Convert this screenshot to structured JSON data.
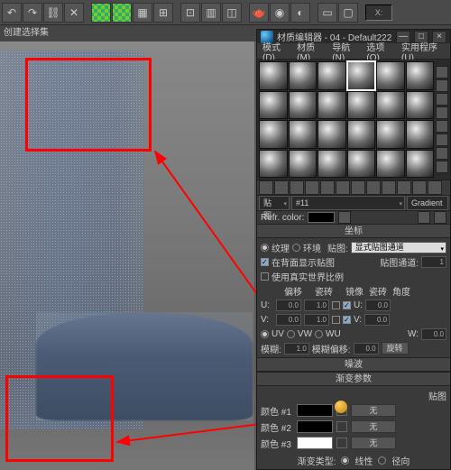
{
  "toolbar": {
    "label_creation": "创建选择集",
    "x_field": "X:"
  },
  "editor": {
    "title": "材质编辑器 - 04 - Default222",
    "menu": {
      "mode": "模式(D)",
      "material": "材质(M)",
      "nav": "导航(N)",
      "options": "选项(O)",
      "util": "实用程序(U)"
    },
    "slot_name_label": "贴图",
    "slot_name": "#11",
    "gradient": "Gradient",
    "refr_label": "Refr. color:"
  },
  "coords": {
    "head": "坐标",
    "tex": "纹理",
    "env": "环境",
    "map": "贴图:",
    "map_type": "显式贴图通道",
    "show_back": "在背面显示贴图",
    "map_ch": "贴图通道:",
    "ch_val": "1",
    "use_real": "使用真实世界比例",
    "offset": "偏移",
    "tile": "瓷砖",
    "mirror": "镜像",
    "tile2": "瓷砖",
    "angle": "角度",
    "u": "U:",
    "v": "V:",
    "w": "W:",
    "wu": "WU",
    "u_off": "0.0",
    "u_tile": "1.0",
    "u_ang": "0.0",
    "v_off": "0.0",
    "v_tile": "1.0",
    "v_ang": "0.0",
    "w_ang": "0.0",
    "uv": "UV",
    "vw": "VW",
    "blur": "模糊:",
    "blur_v": "1.0",
    "blur_off": "模糊偏移:",
    "blur_off_v": "0.0",
    "rotate": "旋转"
  },
  "noise": {
    "head": "噪波",
    "grad_head": "渐变参数",
    "color_image": "贴图",
    "color1": "颜色 #1",
    "color2": "颜色 #2",
    "color3": "颜色 #3",
    "none": "无",
    "grad_type": "渐变类型:",
    "linear": "线性",
    "radial": "径向"
  }
}
